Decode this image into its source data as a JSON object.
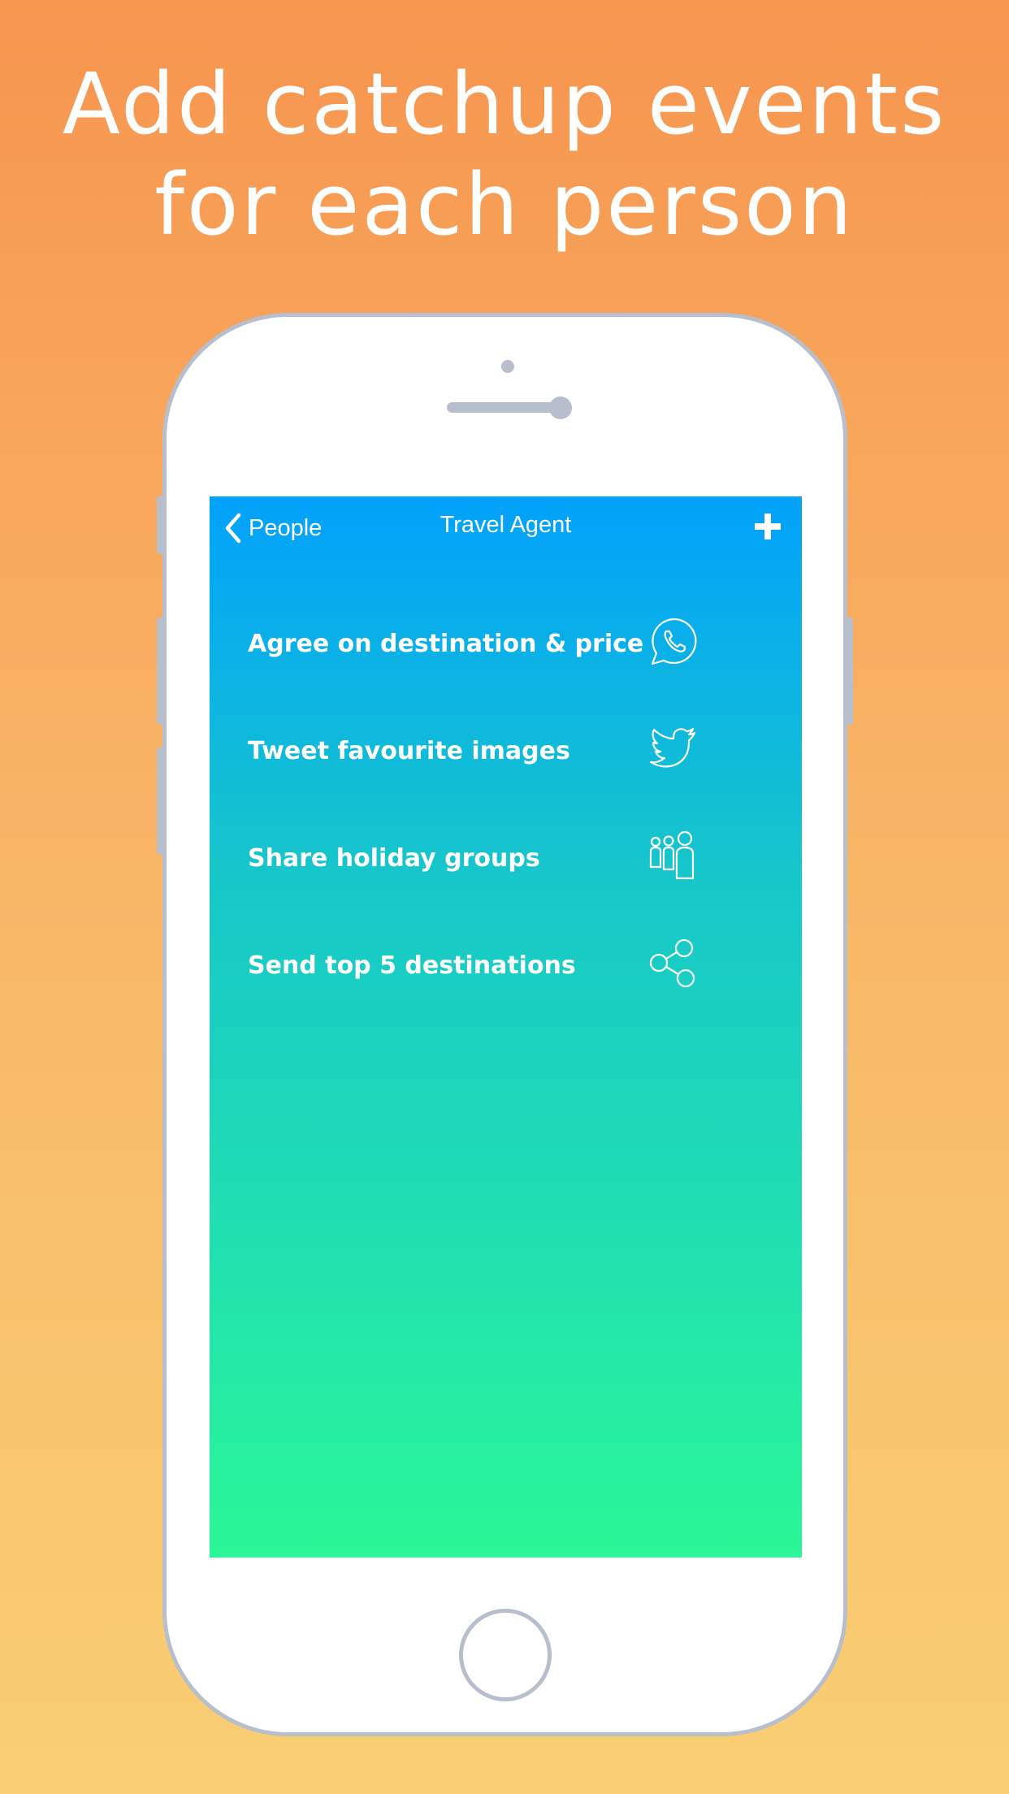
{
  "headline": {
    "line1": "Add catchup events",
    "line2": "for each person"
  },
  "navbar": {
    "back_label": "People",
    "title": "Travel Agent",
    "back_icon": "chevron-left-icon",
    "add_icon": "plus-icon"
  },
  "events": [
    {
      "label": "Agree on destination & price",
      "icon": "whatsapp-icon"
    },
    {
      "label": "Tweet favourite images",
      "icon": "twitter-bird-icon"
    },
    {
      "label": "Share holiday groups",
      "icon": "group-people-icon"
    },
    {
      "label": "Send top 5 destinations",
      "icon": "share-icon"
    }
  ],
  "colors": {
    "background_top": "#f7954f",
    "background_bottom": "#f9cf74",
    "screen_top": "#02a1fb",
    "screen_bottom": "#2af797",
    "phone_outline": "#b8bfcc"
  }
}
